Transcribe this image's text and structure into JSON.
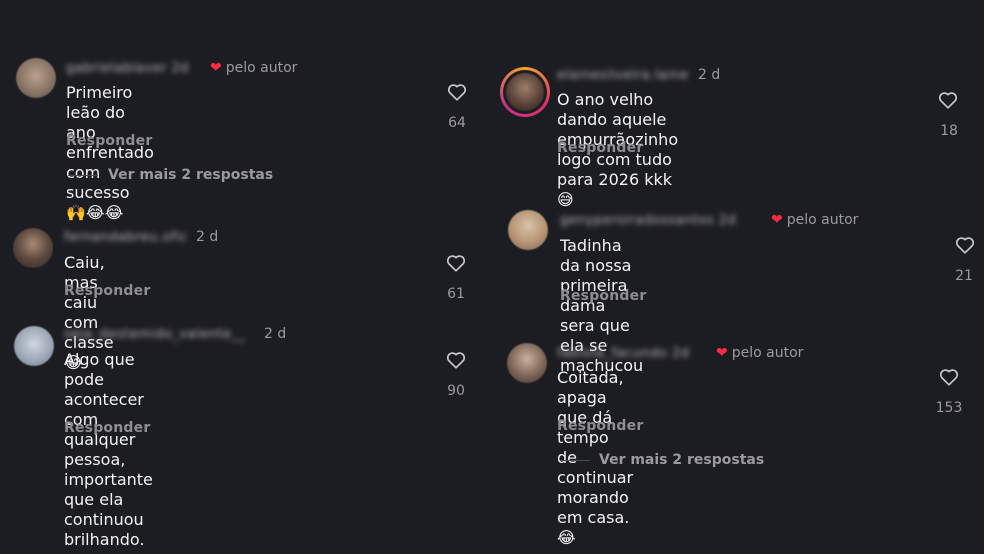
{
  "comments": [
    {
      "username": "gabrielablaver 2d",
      "time": "d",
      "author_label": "pelo autor",
      "text_line1": "Primeiro leão do ano enfrentado com",
      "text_line2": "sucesso 🙌😂😂",
      "reply": "Responder",
      "likes": "64",
      "more_replies": "Ver mais 2 respostas"
    },
    {
      "username": "fernandabreu.ofic",
      "time": "2 d",
      "text_line1": "Caiu, mas caiu com classe 😂",
      "reply": "Responder",
      "likes": "61"
    },
    {
      "username": "seja_destemido_valente__",
      "time": "2 d",
      "text_line1": "Algo que pode acontecer com qualquer",
      "text_line2": "pessoa, importante que ela continuou",
      "text_line3": "brilhando.",
      "reply": "Responder",
      "likes": "90"
    },
    {
      "username": "elainesilveira.laine",
      "time": "2 d",
      "text_line1": "O ano velho dando aquele empurrãozinho",
      "text_line2": "logo  com tudo para 2026 kkk 😅",
      "reply": "Responder",
      "likes": "18"
    },
    {
      "username": "genyperoiradossantos 2d",
      "author_label": "pelo autor",
      "text_line1": "Tadinha da nossa primeira dama sera que",
      "text_line2": "ela se machucou",
      "reply": "Responder",
      "likes": "21"
    },
    {
      "username": "fabiola_facundo 2d",
      "author_label": "pelo autor",
      "text_line1": "Coitada, apaga que dá tempo de continuar",
      "text_line2": "morando em casa. 😂",
      "reply": "Responder",
      "likes": "153",
      "more_replies": "Ver mais 2 respostas"
    }
  ],
  "colors": {
    "background": "#1c1d22",
    "author_heart": "#ff2a45",
    "story_ring": "#e1306c"
  },
  "icons": {
    "like": "heart-outline-icon",
    "author_like": "heart-filled-icon"
  }
}
